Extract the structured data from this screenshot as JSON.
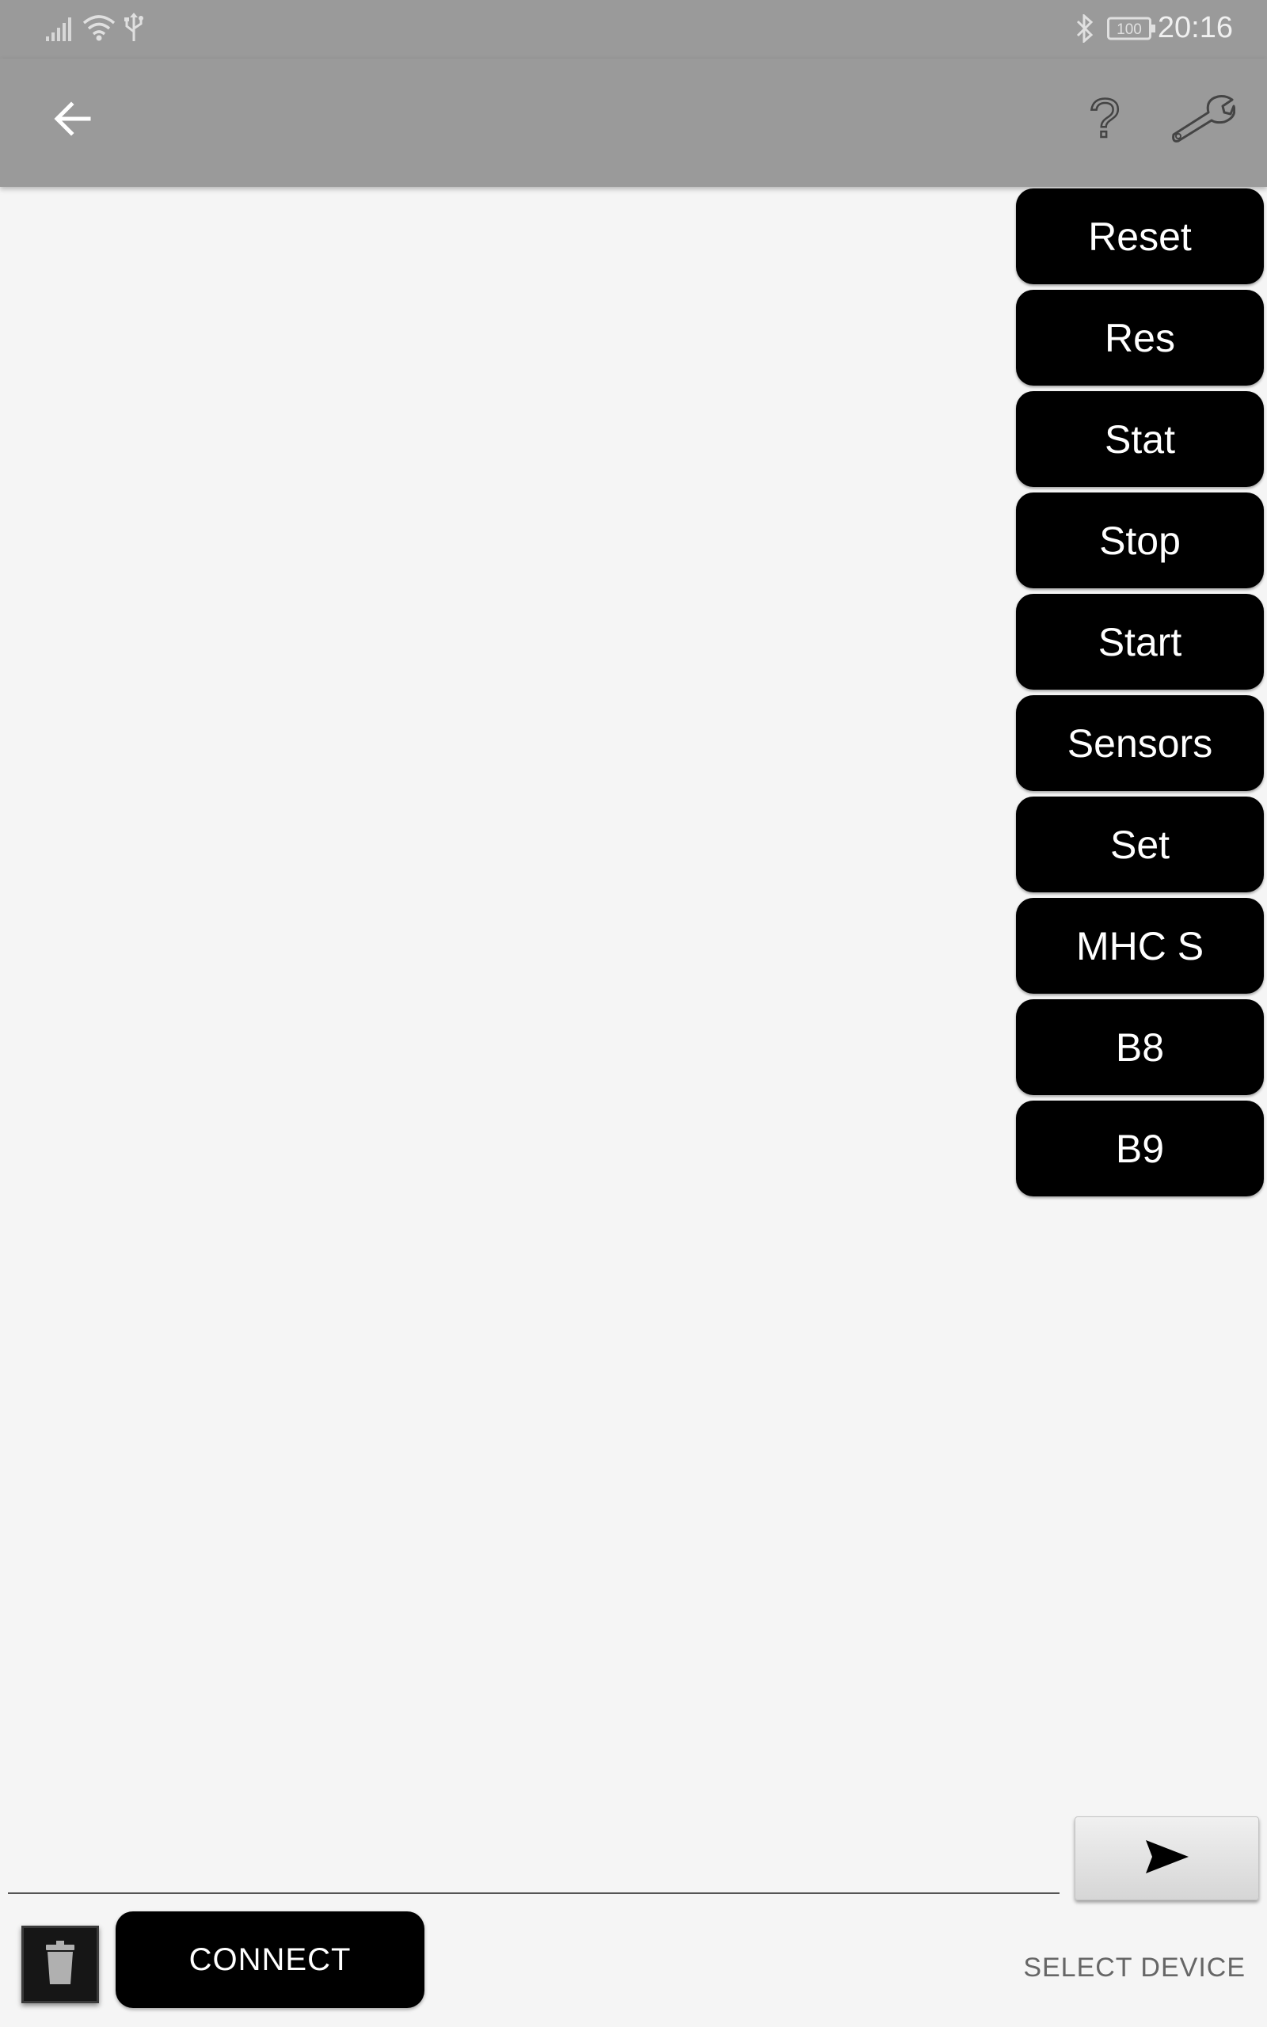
{
  "status_bar": {
    "time": "20:16",
    "battery_level": "100",
    "icons": [
      "signal-icon",
      "wifi-icon",
      "usb-icon",
      "bluetooth-icon",
      "battery-icon"
    ]
  },
  "toolbar": {
    "icons": [
      "back-arrow-icon",
      "help-icon",
      "wrench-icon"
    ],
    "help_label": "?"
  },
  "commands": [
    {
      "label": "Reset"
    },
    {
      "label": "Res"
    },
    {
      "label": "Stat"
    },
    {
      "label": "Stop"
    },
    {
      "label": "Start"
    },
    {
      "label": "Sensors"
    },
    {
      "label": "Set"
    },
    {
      "label": "MHC S"
    },
    {
      "label": "B8"
    },
    {
      "label": "B9"
    }
  ],
  "message": {
    "value": "",
    "placeholder": ""
  },
  "bottom": {
    "connect_label": "CONNECT",
    "select_device_label": "SELECT DEVICE"
  },
  "colors": {
    "app_bar": "#9a9a9a",
    "background": "#f5f5f5",
    "button": "#000000",
    "button_text": "#ffffff"
  }
}
